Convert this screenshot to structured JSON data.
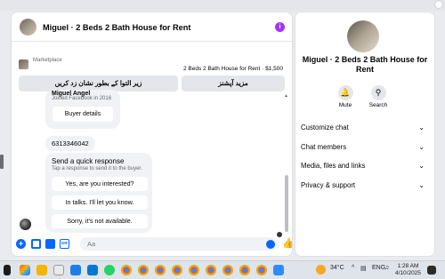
{
  "chat": {
    "title": "Miguel · 2 Beds 2 Bath House for Rent",
    "marketplace_label": "Marketplace",
    "listing": "2 Beds 2 Bath House for Rent · $1,500",
    "btn_urdu": "زیر التوا کے بطور نشان زد کریں",
    "btn_more": "مزید آپشنز",
    "card_name": "Miguel Angel",
    "joined": "Joined Facebook in 2016",
    "buyer_details": "Buyer details",
    "phone": "6313346042",
    "quick_title": "Send a quick response",
    "quick_sub": "Tap a response to send it to the buyer.",
    "quick": [
      "Yes, are you interested?",
      "In talks. I'll let you know.",
      "Sorry, it's not available."
    ],
    "composer_placeholder": "Aa"
  },
  "panel": {
    "title": "Miguel · 2 Beds 2 Bath House for Rent",
    "mute": "Mute",
    "search": "Search",
    "rows": [
      "Customize chat",
      "Chat members",
      "Media, files and links",
      "Privacy & support"
    ]
  },
  "taskbar": {
    "temp": "34°C",
    "lang": "ENG",
    "time": "1:28 AM",
    "date": "4/10/2025"
  },
  "colors": {
    "accent": "#0866ff",
    "info": "#a334fa"
  }
}
